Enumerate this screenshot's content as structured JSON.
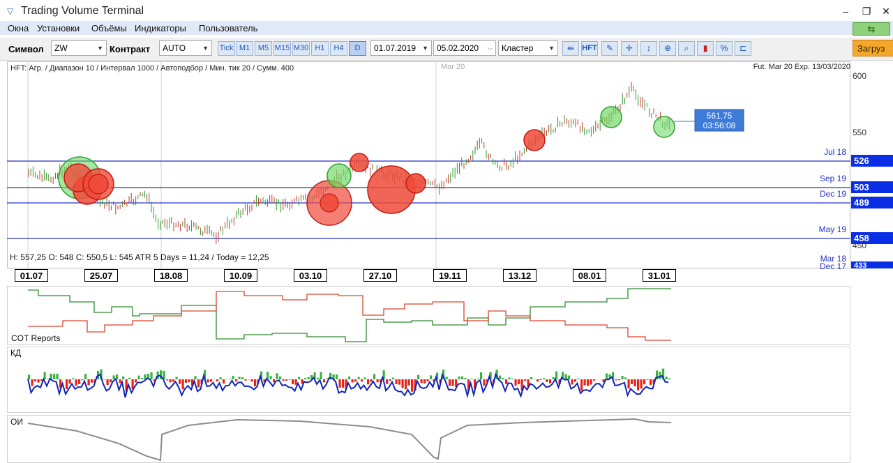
{
  "window": {
    "title": "Trading Volume Terminal"
  },
  "menu": {
    "items": [
      "Окна",
      "Установки",
      "Объёмы",
      "Индикаторы",
      "Пользователь"
    ]
  },
  "toolbar": {
    "symbol_label": "Символ",
    "symbol_value": "ZW",
    "contract_label": "Контракт",
    "contract_value": "AUTO",
    "timeframes": [
      "Tick",
      "M1",
      "M5",
      "M15",
      "M30",
      "H1",
      "H4",
      "D"
    ],
    "active_timeframe": "D",
    "date_from": "01.07.2019",
    "date_to": "05.02.2020",
    "mode": "Кластер",
    "hft_label": "HFT",
    "load_label": "Загруз"
  },
  "chart": {
    "info_line": "HFT: Агр. / Диапазон 10 / Интервал 1000 / Автоподбор / Мин. тик 20 / Сумм. 400",
    "contract_info": "Fut. Mar 20 Exp. 13/03/2020",
    "contract_marker": "Mar 20",
    "ohlc_line": "H: 557,25   O: 548   C: 550,5   L: 545   ATR 5 Days = 11,24 / Today = 12,25",
    "price_ticks": [
      "600",
      "550",
      "450"
    ],
    "levels": [
      {
        "name": "Jul 18",
        "value": "526"
      },
      {
        "name": "Sep 19",
        "value": "503"
      },
      {
        "name": "Dec 19",
        "value": "489"
      },
      {
        "name": "May 19",
        "value": "458"
      },
      {
        "name": "Mar 18",
        "value": "433"
      },
      {
        "name": "Dec 17",
        "value": ""
      }
    ],
    "crosshair": {
      "price": "561,75",
      "time": "03:56:08"
    },
    "dates": [
      "01.07",
      "25.07",
      "18.08",
      "10.09",
      "03.10",
      "27.10",
      "19.11",
      "13.12",
      "08.01",
      "31.01"
    ]
  },
  "panels": {
    "cot_label": "COT Reports",
    "delta_label": "КД",
    "oi_label": "ОИ"
  },
  "colors": {
    "up": "#3cb043",
    "down": "#e8231a",
    "level": "#2430c8",
    "line": "#1224b8",
    "menu_bg": "#dfe9f7"
  }
}
